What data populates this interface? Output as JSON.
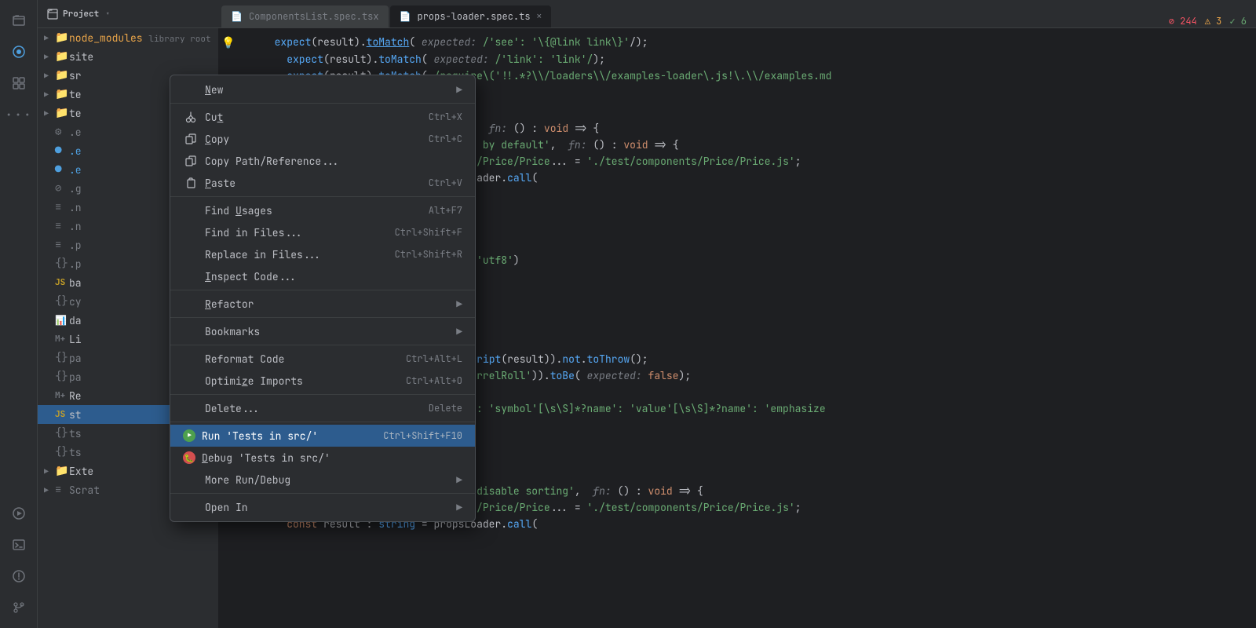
{
  "sidebar_icons": {
    "project": "📁",
    "vcs": "⊙",
    "plugins": "⊞",
    "more": "…",
    "run": "▶",
    "terminal": "⬛",
    "problems": "⚠",
    "git": "⑂"
  },
  "file_tree": {
    "header": "Project",
    "items": [
      {
        "level": 0,
        "arrow": "▶",
        "icon": "📁",
        "label": "node_modules",
        "extra": " library root",
        "color": "orange"
      },
      {
        "level": 0,
        "arrow": "▶",
        "icon": "📁",
        "label": "site",
        "color": "default"
      },
      {
        "level": 0,
        "arrow": "▶",
        "icon": "📁",
        "label": "sr",
        "color": "default"
      },
      {
        "level": 0,
        "arrow": "▶",
        "icon": "📁",
        "label": "te",
        "color": "default"
      },
      {
        "level": 0,
        "arrow": "▶",
        "icon": "📁",
        "label": "te",
        "color": "default"
      },
      {
        "level": 0,
        "icon": "⚙",
        "label": ".e",
        "color": "gray"
      },
      {
        "level": 0,
        "icon": "●",
        "label": ".e",
        "color": "blue"
      },
      {
        "level": 0,
        "icon": "●",
        "label": ".e",
        "color": "blue"
      },
      {
        "level": 0,
        "icon": "⊘",
        "label": ".g",
        "color": "gray"
      },
      {
        "level": 0,
        "icon": "≡",
        "label": ".n",
        "color": "gray"
      },
      {
        "level": 0,
        "icon": "≡",
        "label": ".n",
        "color": "gray"
      },
      {
        "level": 0,
        "icon": "≡",
        "label": ".p",
        "color": "gray"
      },
      {
        "level": 0,
        "icon": "{}",
        "label": ".p",
        "color": "gray"
      },
      {
        "level": 0,
        "icon": "JS",
        "label": "ba",
        "color": "default"
      },
      {
        "level": 0,
        "icon": "{}",
        "label": "cy",
        "color": "gray"
      },
      {
        "level": 0,
        "icon": "📊",
        "label": "da",
        "color": "default"
      },
      {
        "level": 0,
        "icon": "M+",
        "label": "Li",
        "color": "default"
      },
      {
        "level": 0,
        "icon": "{}",
        "label": "pa",
        "color": "gray"
      },
      {
        "level": 0,
        "icon": "{}",
        "label": "pa",
        "color": "gray"
      },
      {
        "level": 0,
        "icon": "M+",
        "label": "Re",
        "color": "default"
      },
      {
        "level": 0,
        "icon": "JS",
        "label": "st",
        "color": "yellow",
        "selected": true
      },
      {
        "level": 0,
        "icon": "{}",
        "label": "ts",
        "color": "gray"
      },
      {
        "level": 0,
        "icon": "{}",
        "label": "ts",
        "color": "gray"
      },
      {
        "level": 0,
        "icon": "📁",
        "label": "Exte",
        "color": "default"
      },
      {
        "level": 0,
        "icon": "≡",
        "label": "Scrat",
        "color": "gray"
      }
    ]
  },
  "context_menu": {
    "items": [
      {
        "id": "new",
        "label": "New",
        "has_submenu": true,
        "shortcut": ""
      },
      {
        "id": "separator1",
        "type": "separator"
      },
      {
        "id": "cut",
        "icon": "✂",
        "label": "Cut",
        "shortcut": "Ctrl+X"
      },
      {
        "id": "copy",
        "icon": "📋",
        "label": "Copy",
        "shortcut": "Ctrl+C"
      },
      {
        "id": "copy-path",
        "icon": "📋",
        "label": "Copy Path/Reference...",
        "shortcut": ""
      },
      {
        "id": "paste",
        "icon": "📋",
        "label": "Paste",
        "shortcut": "Ctrl+V"
      },
      {
        "id": "separator2",
        "type": "separator"
      },
      {
        "id": "find-usages",
        "label": "Find Usages",
        "shortcut": "Alt+F7"
      },
      {
        "id": "find-in-files",
        "label": "Find in Files...",
        "shortcut": "Ctrl+Shift+F"
      },
      {
        "id": "replace-in-files",
        "label": "Replace in Files...",
        "shortcut": "Ctrl+Shift+R"
      },
      {
        "id": "inspect-code",
        "label": "Inspect Code...",
        "shortcut": ""
      },
      {
        "id": "separator3",
        "type": "separator"
      },
      {
        "id": "refactor",
        "label": "Refactor",
        "has_submenu": true,
        "shortcut": ""
      },
      {
        "id": "separator4",
        "type": "separator"
      },
      {
        "id": "bookmarks",
        "label": "Bookmarks",
        "has_submenu": true,
        "shortcut": ""
      },
      {
        "id": "separator5",
        "type": "separator"
      },
      {
        "id": "reformat",
        "label": "Reformat Code",
        "shortcut": "Ctrl+Alt+L"
      },
      {
        "id": "optimize-imports",
        "label": "Optimize Imports",
        "shortcut": "Ctrl+Alt+O"
      },
      {
        "id": "separator6",
        "type": "separator"
      },
      {
        "id": "delete",
        "label": "Delete...",
        "shortcut": "Delete"
      },
      {
        "id": "separator7",
        "type": "separator"
      },
      {
        "id": "run",
        "label": "Run 'Tests in src/'",
        "shortcut": "Ctrl+Shift+F10",
        "highlighted": true,
        "type_run": true
      },
      {
        "id": "debug",
        "label": "Debug 'Tests in src/'",
        "shortcut": "",
        "type_debug": true
      },
      {
        "id": "more-run",
        "label": "More Run/Debug",
        "has_submenu": true,
        "shortcut": ""
      },
      {
        "id": "separator8",
        "type": "separator"
      },
      {
        "id": "open-in",
        "label": "Open In",
        "has_submenu": true,
        "shortcut": ""
      }
    ]
  },
  "tabs": [
    {
      "id": "components-spec",
      "label": "ComponentsList.spec.tsx",
      "icon": "📄",
      "active": false
    },
    {
      "id": "props-loader-spec",
      "label": "props-loader.spec.ts",
      "icon": "📄",
      "active": true,
      "closeable": true
    }
  ],
  "editor": {
    "status": {
      "errors": "244",
      "warnings": "3",
      "ok": "6"
    }
  }
}
